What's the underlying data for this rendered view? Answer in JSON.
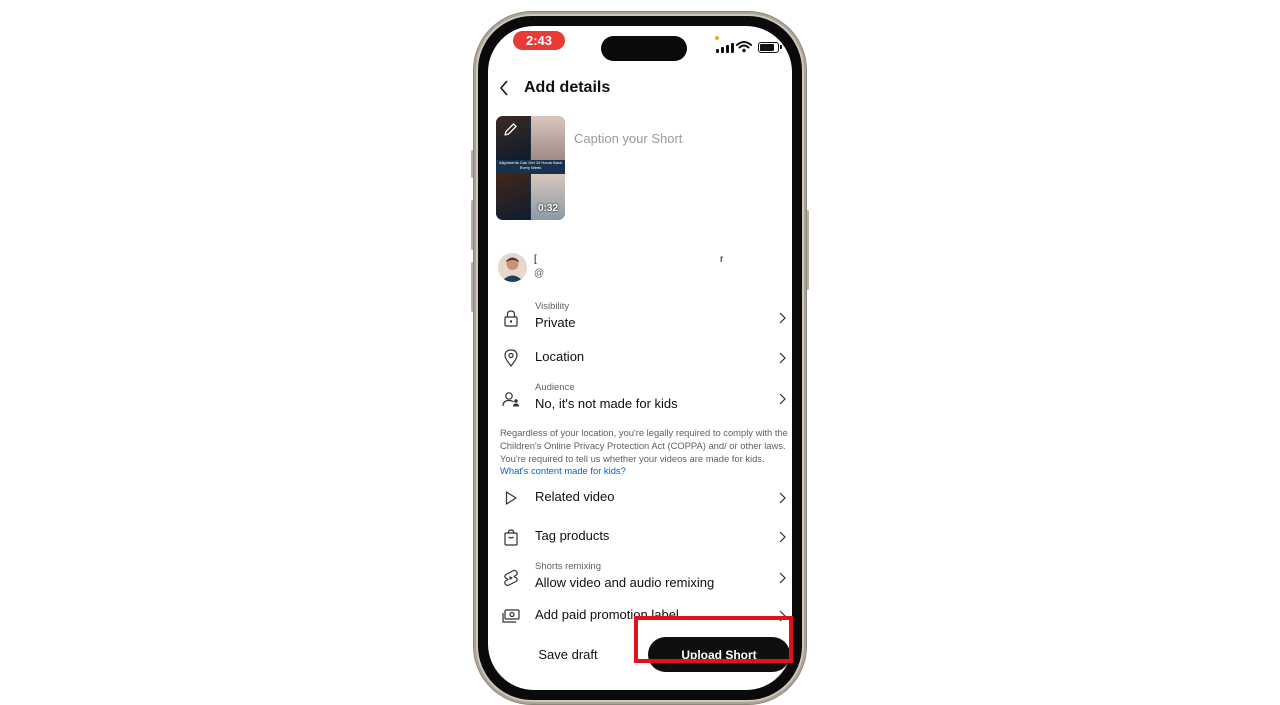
{
  "status_bar": {
    "time": "2:43"
  },
  "header": {
    "title": "Add details"
  },
  "thumbnail": {
    "duration": "0:32",
    "banner_text": "Alignments Can Get 10 Hours Back Every Week"
  },
  "caption": {
    "placeholder": "Caption your Short",
    "value": ""
  },
  "channel": {
    "name": "[",
    "handle": "@",
    "name_tail": "r"
  },
  "settings": [
    {
      "icon": "lock-icon",
      "label": "Visibility",
      "value": "Private"
    },
    {
      "icon": "location-pin-icon",
      "value": "Location"
    },
    {
      "icon": "audience-icon",
      "label": "Audience",
      "value": "No, it's not made for kids"
    },
    {
      "icon": "play-icon",
      "value": "Related video"
    },
    {
      "icon": "shopping-bag-icon",
      "value": "Tag products"
    },
    {
      "icon": "remix-icon",
      "label": "Shorts remixing",
      "value": "Allow video and audio remixing"
    },
    {
      "icon": "paid-promotion-icon",
      "value": "Add paid promotion label"
    }
  ],
  "coppa": {
    "text": "Regardless of your location, you're legally required to comply with the Children's Online Privacy Protection Act (COPPA) and/ or other laws. You're required to tell us whether your videos are made for kids.",
    "link": "What's content made for kids?"
  },
  "actions": {
    "save_draft": "Save draft",
    "upload": "Upload Short"
  },
  "colors": {
    "highlight": "#e3101b",
    "link": "#065fd4",
    "time_pill": "#ea3a35"
  }
}
